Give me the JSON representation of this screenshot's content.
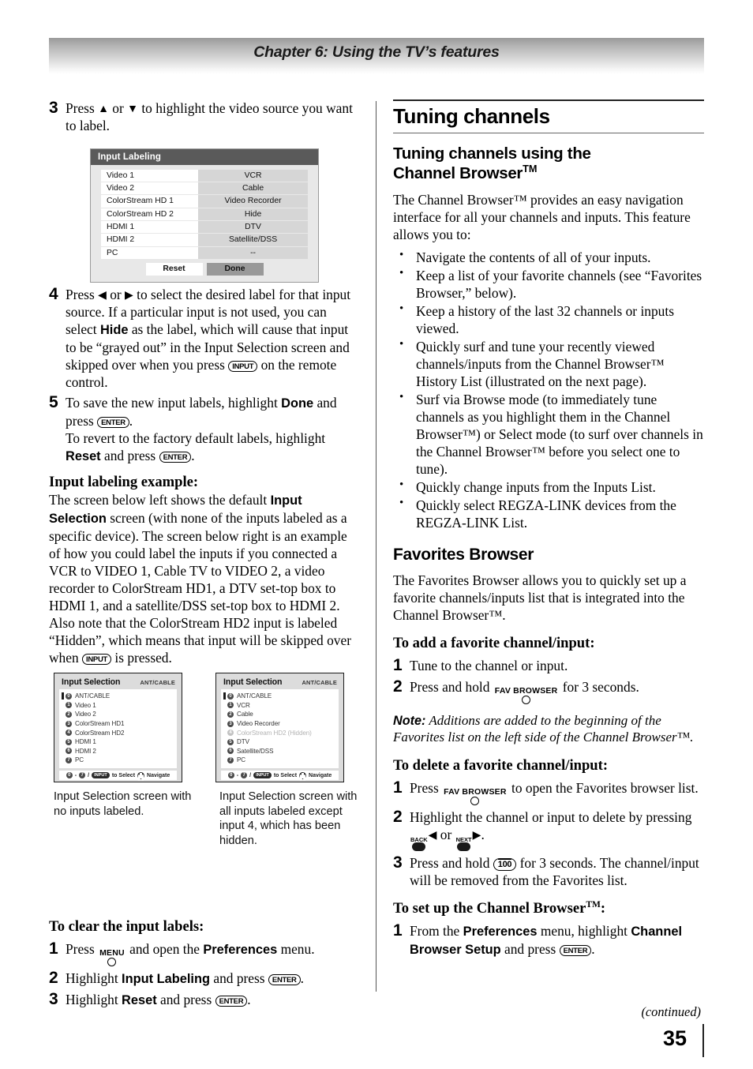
{
  "header": {
    "chapter_title": "Chapter 6: Using the TV’s features"
  },
  "left_column": {
    "step3": {
      "num": "3",
      "text_a": "Press ",
      "text_b": " or ",
      "text_c": " to highlight the video source you want to label."
    },
    "input_labeling_osd": {
      "title": "Input Labeling",
      "rows": [
        {
          "input": "Video 1",
          "label": "VCR"
        },
        {
          "input": "Video 2",
          "label": "Cable"
        },
        {
          "input": "ColorStream HD 1",
          "label": "Video Recorder"
        },
        {
          "input": "ColorStream HD 2",
          "label": "Hide"
        },
        {
          "input": "HDMI 1",
          "label": "DTV"
        },
        {
          "input": "HDMI 2",
          "label": "Satellite/DSS"
        },
        {
          "input": "PC",
          "label": "--"
        }
      ],
      "reset_button": "Reset",
      "done_button": "Done"
    },
    "step4": {
      "num": "4",
      "p1": "Press ",
      "p2": " or ",
      "p3": " to select the desired label for that input source. If a particular input is not used, you can select ",
      "hide": "Hide",
      "p4": " as the label, which will cause that input to be “grayed out” in the Input Selection screen and skipped over when you press ",
      "input_key": "INPUT",
      "p5": " on the remote control."
    },
    "step5": {
      "num": "5",
      "p1": "To save the new input labels, highlight ",
      "done": "Done",
      "p2": " and press ",
      "enter_key": "ENTER",
      "p3": ".",
      "p4": "To revert to the factory default labels, highlight ",
      "reset": "Reset",
      "p5": " and press ",
      "p6": "."
    },
    "example": {
      "heading": "Input labeling example:",
      "p1": "The screen below left shows the default ",
      "bold1": "Input Selection",
      "p2": " screen (with none of the inputs labeled as a specific device). The screen below right is an example of how you could label the inputs if you connected a VCR to VIDEO 1, Cable TV to VIDEO 2, a video recorder to ColorStream HD1, a DTV set-top box to HDMI 1, and a satellite/DSS set-top box to HDMI 2. Also note that the ColorStream HD2 input is labeled “Hidden”, which means that input will be skipped over when ",
      "input_key": "INPUT",
      "p3": " is pressed."
    },
    "input_selection_default": {
      "title": "Input Selection",
      "source_badge": "ANT/CABLE",
      "items": [
        {
          "num": "0",
          "label": "ANT/CABLE",
          "dim": false,
          "current": true
        },
        {
          "num": "1",
          "label": "Video 1",
          "dim": false,
          "current": false
        },
        {
          "num": "2",
          "label": "Video 2",
          "dim": false,
          "current": false
        },
        {
          "num": "3",
          "label": "ColorStream HD1",
          "dim": false,
          "current": false
        },
        {
          "num": "4",
          "label": "ColorStream HD2",
          "dim": false,
          "current": false
        },
        {
          "num": "5",
          "label": "HDMI 1",
          "dim": false,
          "current": false
        },
        {
          "num": "6",
          "label": "HDMI 2",
          "dim": false,
          "current": false
        },
        {
          "num": "7",
          "label": "PC",
          "dim": false,
          "current": false
        }
      ],
      "footer": {
        "range_from": "0",
        "dash": "-",
        "range_to": "7",
        "slash": "/",
        "input_key": "INPUT",
        "select_text": "to Select",
        "navigate_text": "Navigate"
      }
    },
    "input_selection_labeled": {
      "title": "Input Selection",
      "source_badge": "ANT/CABLE",
      "items": [
        {
          "num": "0",
          "label": "ANT/CABLE",
          "dim": false,
          "current": true
        },
        {
          "num": "1",
          "label": "VCR",
          "dim": false,
          "current": false
        },
        {
          "num": "2",
          "label": "Cable",
          "dim": false,
          "current": false
        },
        {
          "num": "3",
          "label": "Video Recorder",
          "dim": false,
          "current": false
        },
        {
          "num": "4",
          "label": "ColorStream HD2 (Hidden)",
          "dim": true,
          "current": false
        },
        {
          "num": "5",
          "label": "DTV",
          "dim": false,
          "current": false
        },
        {
          "num": "6",
          "label": "Satellite/DSS",
          "dim": false,
          "current": false
        },
        {
          "num": "7",
          "label": "PC",
          "dim": false,
          "current": false
        }
      ],
      "footer": {
        "range_from": "0",
        "dash": "-",
        "range_to": "7",
        "slash": "/",
        "input_key": "INPUT",
        "select_text": "to Select",
        "navigate_text": "Navigate"
      }
    },
    "caption_left": "Input Selection screen with  no inputs labeled.",
    "caption_right": "Input Selection screen with all inputs labeled except input 4, which has been hidden.",
    "clear_labels": {
      "heading": "To clear the input labels:",
      "step1": {
        "num": "1",
        "p1": "Press ",
        "menu_key": "MENU",
        "p2": " and open the ",
        "bold": "Preferences",
        "p3": " menu."
      },
      "step2": {
        "num": "2",
        "p1": "Highlight ",
        "bold": "Input Labeling",
        "p2": " and press ",
        "enter_key": "ENTER",
        "p3": "."
      },
      "step3": {
        "num": "3",
        "p1": "Highlight ",
        "bold": "Reset",
        "p2": " and press ",
        "enter_key": "ENTER",
        "p3": "."
      }
    }
  },
  "right_column": {
    "section_title": "Tuning channels",
    "subsection_title_line1": "Tuning channels using the",
    "subsection_title_line2": "Channel Browser",
    "tm": "TM",
    "intro": "The Channel Browser™ provides an easy navigation interface for all your channels and inputs. This feature allows you to:",
    "bullets": [
      "Navigate the contents of all of your inputs.",
      "Keep a list of your favorite channels (see “Favorites Browser,” below).",
      "Keep a history of the last 32 channels or inputs viewed.",
      "Quickly surf and tune your recently viewed channels/inputs from the Channel Browser™ History List (illustrated on the next page).",
      "Surf via Browse mode (to immediately tune channels as you highlight them in the Channel Browser™) or Select mode (to surf over channels in the Channel Browser™ before you select one to tune).",
      "Quickly change inputs from the Inputs List.",
      "Quickly select REGZA-LINK devices from the REGZA-LINK List."
    ],
    "favorites_heading": "Favorites Browser",
    "favorites_intro": "The Favorites Browser allows you to quickly set up a favorite channels/inputs list that is integrated into the Channel Browser™.",
    "add_favorite": {
      "heading": "To add a favorite channel/input:",
      "step1": {
        "num": "1",
        "text": "Tune to the channel or input."
      },
      "step2": {
        "num": "2",
        "p1": "Press and hold ",
        "fav_key": "FAV BROWSER",
        "p2": " for 3 seconds."
      }
    },
    "note": {
      "label": "Note:",
      "text": " Additions are added to the beginning of the Favorites list on the left side of the Channel Browser™."
    },
    "delete_favorite": {
      "heading": "To delete a favorite channel/input:",
      "step1": {
        "num": "1",
        "p1": "Press ",
        "fav_key": "FAV BROWSER",
        "p2": " to open the Favorites browser list."
      },
      "step2": {
        "num": "2",
        "p1": "Highlight the channel or input to delete by pressing ",
        "back_key": "BACK",
        "p2": " or ",
        "next_key": "NEXT",
        "p3": "."
      },
      "step3": {
        "num": "3",
        "p1": "Press and hold ",
        "hundred_key": "100",
        "p2": " for 3 seconds. The channel/input will be removed from the Favorites list."
      }
    },
    "setup_browser": {
      "heading_a": "To set up the Channel Browser",
      "tm": "TM",
      "heading_b": ":",
      "step1": {
        "num": "1",
        "p1": "From the ",
        "bold1": "Preferences",
        "p2": " menu, highlight ",
        "bold2": "Channel Browser Setup",
        "p3": " and press ",
        "enter_key": "ENTER",
        "p4": "."
      }
    }
  },
  "footer": {
    "continued": "(continued)",
    "page_number": "35"
  }
}
